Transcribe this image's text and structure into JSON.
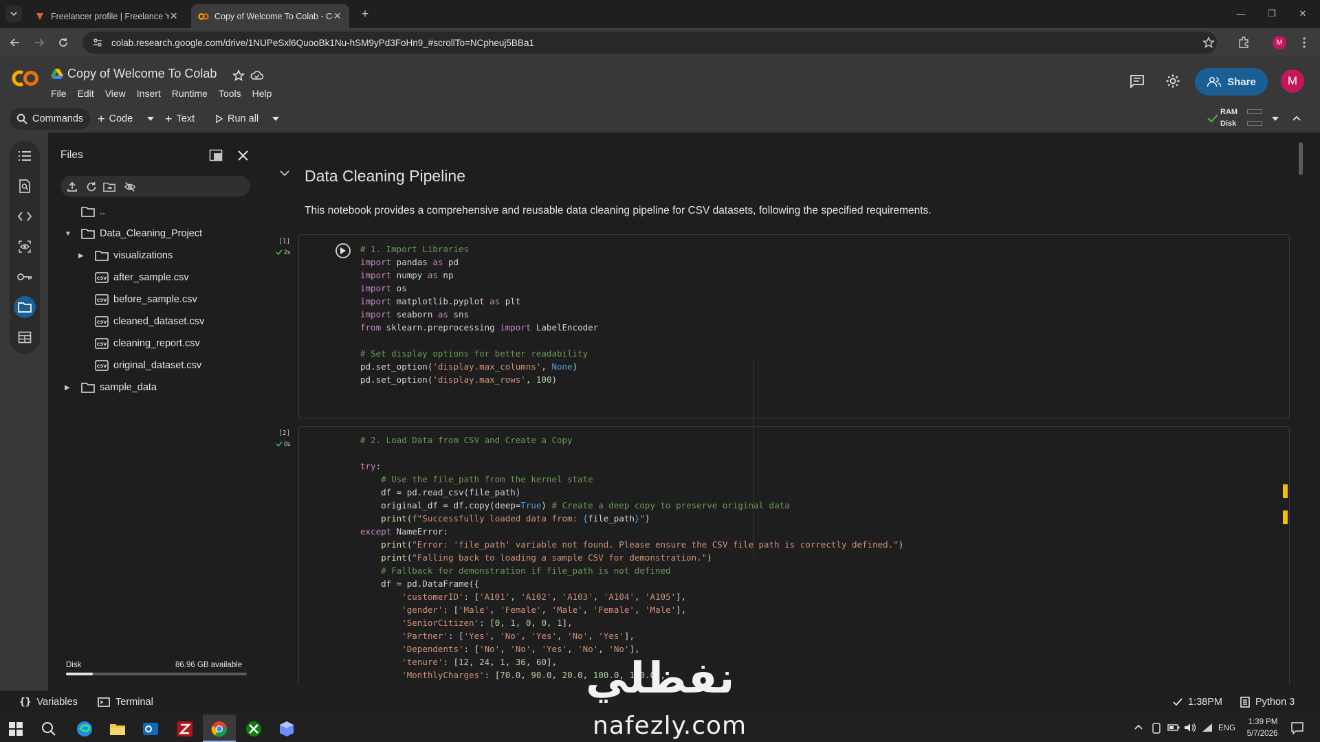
{
  "browser": {
    "tabs": [
      {
        "label": "Freelancer profile | Freelance Yo",
        "active": false
      },
      {
        "label": "Copy of Welcome To Colab - Co",
        "active": true
      }
    ],
    "url": "colab.research.google.com/drive/1NUPeSxl6QuooBk1Nu-hSM9yPd3FoHn9_#scrollTo=NCpheuj5BBa1",
    "profile_initial": "M"
  },
  "colab": {
    "notebook_title": "Copy of Welcome To Colab",
    "menu": [
      "File",
      "Edit",
      "View",
      "Insert",
      "Runtime",
      "Tools",
      "Help"
    ],
    "share_label": "Share",
    "avatar_initial": "M",
    "toolbar": {
      "commands": "Commands",
      "code": "Code",
      "text": "Text",
      "run_all": "Run all",
      "ram_label": "RAM",
      "disk_label": "Disk"
    }
  },
  "files_panel": {
    "title": "Files",
    "tree": [
      {
        "name": "..",
        "type": "folder",
        "depth": 0,
        "caret": ""
      },
      {
        "name": "Data_Cleaning_Project",
        "type": "folder",
        "depth": 0,
        "caret": "expanded"
      },
      {
        "name": "visualizations",
        "type": "folder",
        "depth": 1,
        "caret": "collapsed"
      },
      {
        "name": "after_sample.csv",
        "type": "csv",
        "depth": 1,
        "caret": ""
      },
      {
        "name": "before_sample.csv",
        "type": "csv",
        "depth": 1,
        "caret": ""
      },
      {
        "name": "cleaned_dataset.csv",
        "type": "csv",
        "depth": 1,
        "caret": ""
      },
      {
        "name": "cleaning_report.csv",
        "type": "csv",
        "depth": 1,
        "caret": ""
      },
      {
        "name": "original_dataset.csv",
        "type": "csv",
        "depth": 1,
        "caret": ""
      },
      {
        "name": "sample_data",
        "type": "folder",
        "depth": 0,
        "caret": "collapsed"
      }
    ],
    "disk_label": "Disk",
    "disk_available": "86.96 GB available",
    "disk_used_fraction": 0.15
  },
  "notebook": {
    "section_title": "Data Cleaning Pipeline",
    "section_description": "This notebook provides a comprehensive and reusable data cleaning pipeline for CSV datasets, following the specified requirements.",
    "cells": [
      {
        "exec_count": "[1]",
        "exec_time": "2s"
      },
      {
        "exec_count": "[2]",
        "exec_time": "0s"
      }
    ]
  },
  "statusbar": {
    "variables": "Variables",
    "terminal": "Terminal",
    "time": "1:38PM",
    "runtime": "Python 3"
  },
  "taskbar": {
    "language": "ENG",
    "time": "1:39 PM",
    "date": "5/7/2026"
  },
  "watermark": {
    "arabic": "نفظلي",
    "latin": "nafezly.com"
  }
}
